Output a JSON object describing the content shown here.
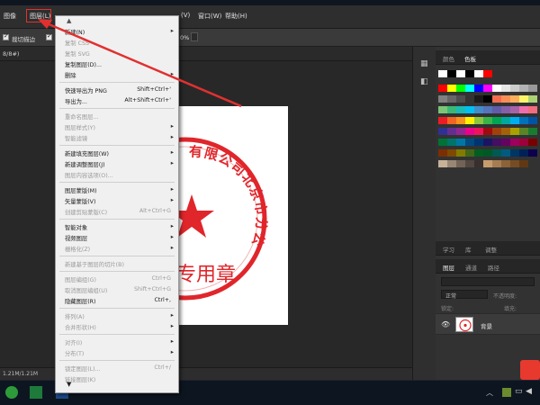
{
  "menubar": {
    "items": [
      "图像",
      "图层(L)",
      "(V)",
      "窗口(W)",
      "帮助(H)"
    ]
  },
  "options": {
    "label1": "裁切描边",
    "percent": "0%"
  },
  "tab": {
    "label": "8/8#)"
  },
  "status": {
    "text": "1.21M/1.21M"
  },
  "swatches_panel": {
    "tabs": [
      "颜色",
      "色板"
    ]
  },
  "layers_panel": {
    "top_tabs": [
      "学习",
      "库",
      "调整"
    ],
    "tabs": [
      "图层",
      "通道",
      "路径"
    ],
    "blend_mode": "正常",
    "opacity_label": "不透明度:",
    "lock_label": "锁定:",
    "fill_label": "填充:",
    "layer_name": "背景"
  },
  "menu": {
    "items": [
      {
        "label": "新建(N)",
        "shortcut": "",
        "submenu": true,
        "disabled": false
      },
      {
        "label": "复制 CSS",
        "shortcut": "",
        "submenu": false,
        "disabled": true
      },
      {
        "label": "复制 SVG",
        "shortcut": "",
        "submenu": false,
        "disabled": true
      },
      {
        "label": "复制图层(D)...",
        "shortcut": "",
        "submenu": false,
        "disabled": false
      },
      {
        "label": "删除",
        "shortcut": "",
        "submenu": true,
        "disabled": false
      },
      {
        "label": "快速导出为 PNG",
        "shortcut": "Shift+Ctrl+'",
        "submenu": false,
        "disabled": false
      },
      {
        "label": "导出为...",
        "shortcut": "Alt+Shift+Ctrl+'",
        "submenu": false,
        "disabled": false
      },
      {
        "label": "重命名图层...",
        "shortcut": "",
        "submenu": false,
        "disabled": true
      },
      {
        "label": "图层样式(Y)",
        "shortcut": "",
        "submenu": true,
        "disabled": true
      },
      {
        "label": "智能滤镜",
        "shortcut": "",
        "submenu": true,
        "disabled": true
      },
      {
        "label": "新建填充图层(W)",
        "shortcut": "",
        "submenu": true,
        "disabled": false
      },
      {
        "label": "新建调整图层(J)",
        "shortcut": "",
        "submenu": true,
        "disabled": false
      },
      {
        "label": "图层内容选项(O)...",
        "shortcut": "",
        "submenu": false,
        "disabled": true
      },
      {
        "label": "图层蒙版(M)",
        "shortcut": "",
        "submenu": true,
        "disabled": false
      },
      {
        "label": "矢量蒙版(V)",
        "shortcut": "",
        "submenu": true,
        "disabled": false
      },
      {
        "label": "创建剪贴蒙版(C)",
        "shortcut": "Alt+Ctrl+G",
        "submenu": false,
        "disabled": true
      },
      {
        "label": "智能对象",
        "shortcut": "",
        "submenu": true,
        "disabled": false
      },
      {
        "label": "视频图层",
        "shortcut": "",
        "submenu": true,
        "disabled": false
      },
      {
        "label": "栅格化(Z)",
        "shortcut": "",
        "submenu": true,
        "disabled": true
      },
      {
        "label": "新建基于图层的切片(B)",
        "shortcut": "",
        "submenu": false,
        "disabled": true
      },
      {
        "label": "图层编组(G)",
        "shortcut": "Ctrl+G",
        "submenu": false,
        "disabled": true
      },
      {
        "label": "取消图层编组(U)",
        "shortcut": "Shift+Ctrl+G",
        "submenu": false,
        "disabled": true
      },
      {
        "label": "隐藏图层(R)",
        "shortcut": "Ctrl+,",
        "submenu": false,
        "disabled": false
      },
      {
        "label": "排列(A)",
        "shortcut": "",
        "submenu": true,
        "disabled": true
      },
      {
        "label": "合并形状(H)",
        "shortcut": "",
        "submenu": true,
        "disabled": true
      },
      {
        "label": "对齐(I)",
        "shortcut": "",
        "submenu": true,
        "disabled": true
      },
      {
        "label": "分布(T)",
        "shortcut": "",
        "submenu": true,
        "disabled": true
      },
      {
        "label": "锁定图层(L)...",
        "shortcut": "Ctrl+/",
        "submenu": false,
        "disabled": true
      },
      {
        "label": "链接图层(K)",
        "shortcut": "",
        "submenu": false,
        "disabled": true
      }
    ]
  },
  "stamp": {
    "arc_text": "有限公司北京市分公司",
    "bottom_text": "专用章"
  },
  "colors": {
    "stamp_red": "#e0262b",
    "annotation_red": "#e23030",
    "menu_bg": "#f0f0f0"
  }
}
